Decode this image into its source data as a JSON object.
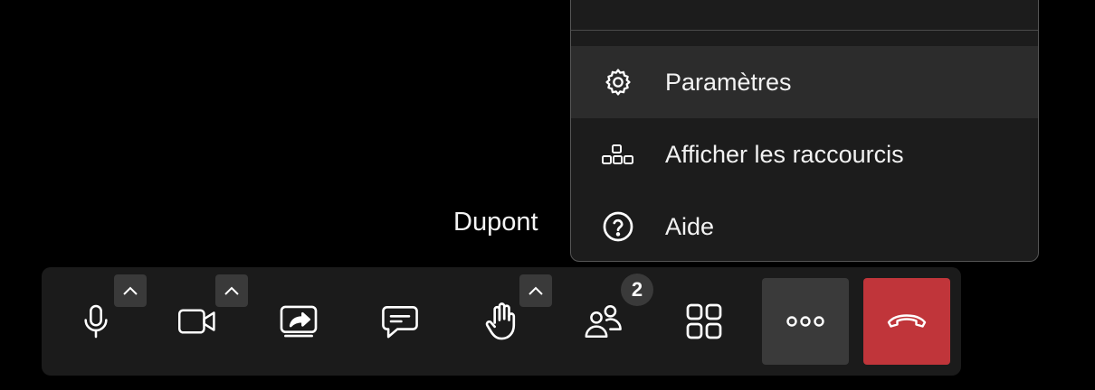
{
  "menu": {
    "items": [
      {
        "label": "Paramètres",
        "icon": "gear-icon",
        "active": true
      },
      {
        "label": "Afficher les raccourcis",
        "icon": "shortcuts-icon",
        "active": false
      },
      {
        "label": "Aide",
        "icon": "help-icon",
        "active": false
      }
    ]
  },
  "participant": {
    "name": "Dupont"
  },
  "toolbar": {
    "buttons": [
      "microphone-icon",
      "camera-icon",
      "share-screen-icon",
      "chat-icon",
      "raise-hand-icon",
      "participants-icon",
      "grid-view-icon",
      "more-options-icon",
      "hang-up-icon"
    ],
    "participants_count": "2",
    "hangup_color": "#c0353a"
  }
}
